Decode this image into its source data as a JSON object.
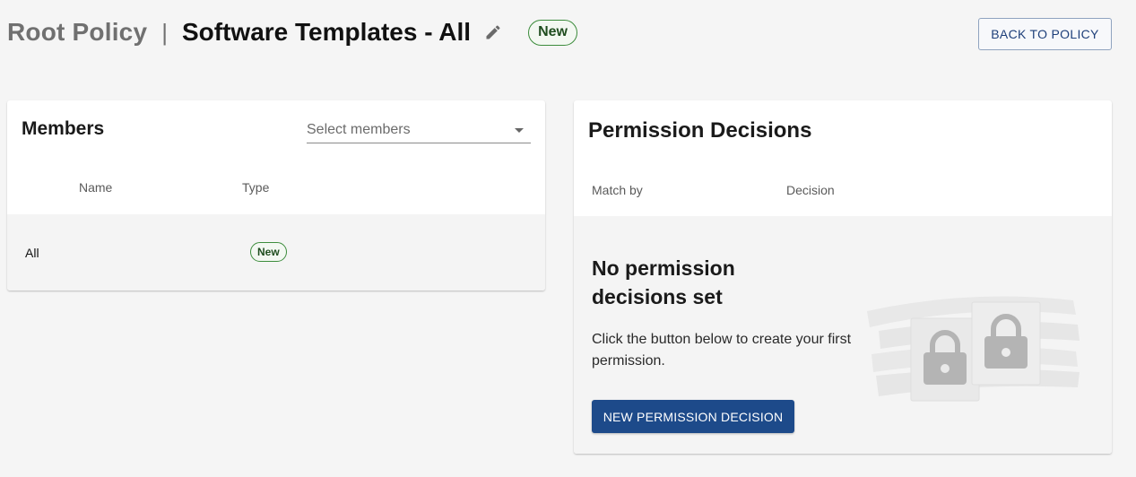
{
  "header": {
    "breadcrumb_root": "Root Policy",
    "separator": "|",
    "title": "Software Templates - All",
    "status_chip": "New",
    "back_button": "BACK TO POLICY"
  },
  "members": {
    "title": "Members",
    "select_placeholder": "Select members",
    "columns": [
      "Name",
      "Type"
    ],
    "rows": [
      {
        "name": "All",
        "type_chip": "New"
      }
    ]
  },
  "permissions": {
    "title": "Permission Decisions",
    "columns": [
      "Match by",
      "Decision"
    ],
    "empty_title": "No permission decisions set",
    "empty_description": "Click the button below to create your first permission.",
    "new_button": "NEW PERMISSION DECISION"
  },
  "icons": {
    "edit": "pencil-icon",
    "dropdown": "chevron-down-icon",
    "illustration": "lock-icon"
  },
  "colors": {
    "primary": "#1d4a8a",
    "chip_border": "#3c8c3c",
    "background": "#f5f5f5"
  }
}
